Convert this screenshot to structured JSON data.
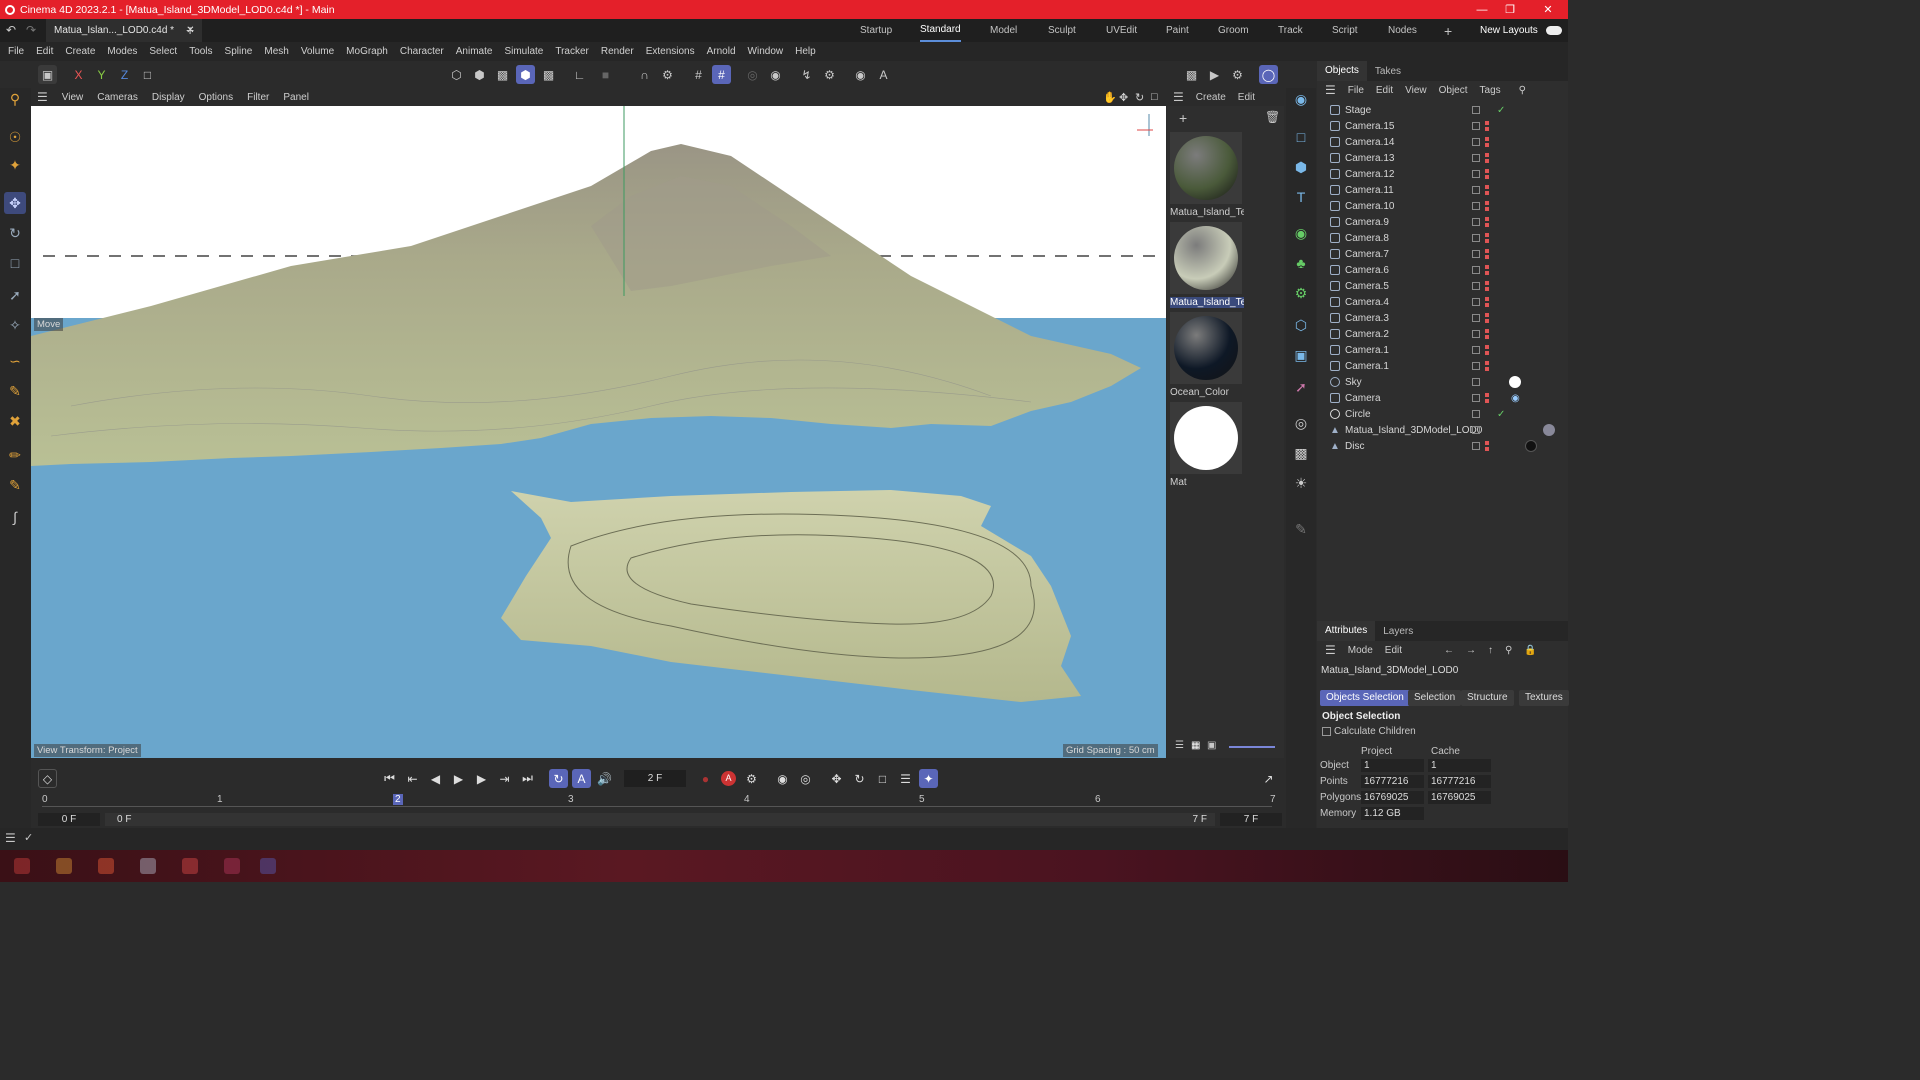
{
  "title": "Cinema 4D 2023.2.1 - [Matua_Island_3DModel_LOD0.c4d *] - Main",
  "doc_tab": "Matua_Islan..._LOD0.c4d *",
  "layouts": [
    "Startup",
    "Standard",
    "Model",
    "Sculpt",
    "UVEdit",
    "Paint",
    "Groom",
    "Track",
    "Script",
    "Nodes"
  ],
  "new_layouts": "New Layouts",
  "menus": [
    "File",
    "Edit",
    "Create",
    "Modes",
    "Select",
    "Tools",
    "Spline",
    "Mesh",
    "Volume",
    "MoGraph",
    "Character",
    "Animate",
    "Simulate",
    "Tracker",
    "Render",
    "Extensions",
    "Arnold",
    "Window",
    "Help"
  ],
  "axes": {
    "x": "X",
    "y": "Y",
    "z": "Z"
  },
  "viewport_menu": [
    "View",
    "Cameras",
    "Display",
    "Options",
    "Filter",
    "Panel"
  ],
  "viewport": {
    "move_label": "Move",
    "view_transform": "View Transform: Project",
    "grid_spacing": "Grid Spacing : 50 cm"
  },
  "materials": {
    "menu": [
      "Create",
      "Edit"
    ],
    "items": [
      {
        "name": "Matua_Island_Text",
        "color": "#4a5a3a"
      },
      {
        "name": "Matua_Island_Text",
        "color": "#c8ccb8"
      },
      {
        "name": "Ocean_Color",
        "color": "#0e1826"
      },
      {
        "name": "Mat",
        "color": "#ffffff"
      }
    ]
  },
  "objects": {
    "tabs": [
      "Objects",
      "Takes"
    ],
    "menu": [
      "File",
      "Edit",
      "View",
      "Object",
      "Tags"
    ],
    "rows": [
      "Stage",
      "Camera.15",
      "Camera.14",
      "Camera.13",
      "Camera.12",
      "Camera.11",
      "Camera.10",
      "Camera.9",
      "Camera.8",
      "Camera.7",
      "Camera.6",
      "Camera.5",
      "Camera.4",
      "Camera.3",
      "Camera.2",
      "Camera.1",
      "Camera.1",
      "Sky",
      "Camera",
      "Circle",
      "Matua_Island_3DModel_LOD0",
      "Disc"
    ]
  },
  "attributes": {
    "tabs": [
      "Attributes",
      "Layers"
    ],
    "menu": [
      "Mode",
      "Edit"
    ],
    "object_name": "Matua_Island_3DModel_LOD0",
    "buttons": [
      "Objects Selection",
      "Selection",
      "Structure",
      "Textures"
    ],
    "section": "Object Selection",
    "calc_children": "Calculate Children",
    "col_project": "Project",
    "col_cache": "Cache",
    "rows": [
      {
        "label": "Object",
        "project": "1",
        "cache": "1"
      },
      {
        "label": "Points",
        "project": "16777216",
        "cache": "16777216"
      },
      {
        "label": "Polygons",
        "project": "16769025",
        "cache": "16769025"
      },
      {
        "label": "Memory",
        "project": "1.12 GB",
        "cache": ""
      }
    ]
  },
  "timeline": {
    "current_frame": "2 F",
    "start": "0 F",
    "start2": "0 F",
    "end": "7 F",
    "end2": "7 F",
    "ruler": [
      "0",
      "1",
      "2",
      "3",
      "4",
      "5",
      "6",
      "7"
    ]
  },
  "colors": {
    "accent": "#5a66b8",
    "titlebar": "#e4202a",
    "ocean": "#6aa6cc",
    "land": "#b7bf92"
  }
}
